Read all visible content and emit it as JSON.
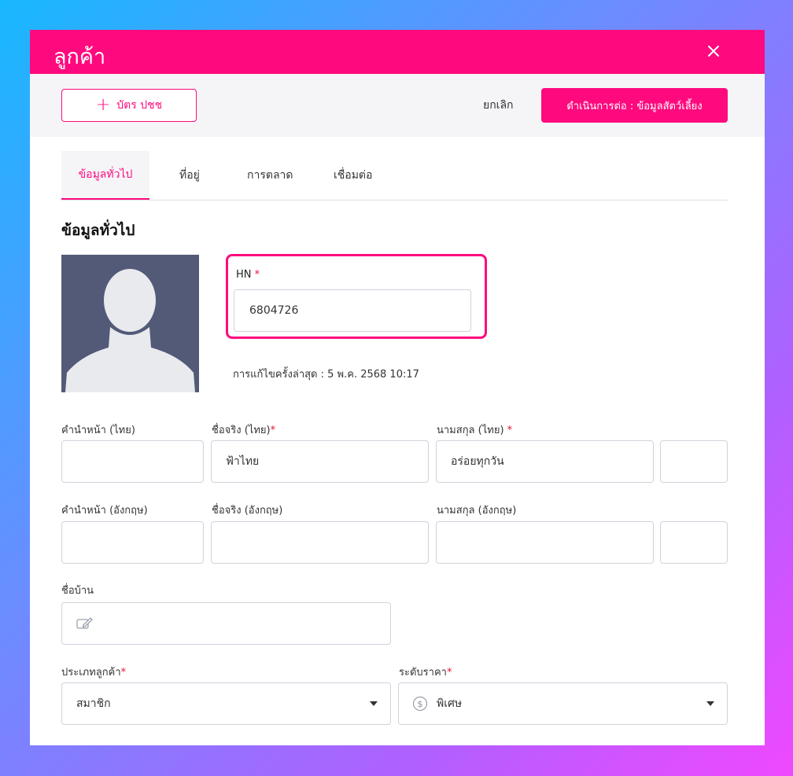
{
  "modal": {
    "title": "ลูกค้า",
    "close_icon": "close-icon"
  },
  "toolbar": {
    "idcard_label": "บัตร ปชช",
    "cancel_label": "ยกเลิก",
    "next_label": "ดำเนินการต่อ : ข้อมูลสัตว์เลี้ยง"
  },
  "tabs": [
    {
      "label": "ข้อมูลทั่วไป",
      "active": true
    },
    {
      "label": "ที่อยู่",
      "active": false
    },
    {
      "label": "การตลาด",
      "active": false
    },
    {
      "label": "เชื่อมต่อ",
      "active": false
    }
  ],
  "section": {
    "title": "ข้อมูลทั่วไป"
  },
  "hn": {
    "label": "HN",
    "required": "*",
    "value": "6804726"
  },
  "last_edit": "การแก้ไขครั้งล่าสุด : 5 พ.ค. 2568 10:17",
  "thai_name": {
    "prefix_label": "คำนำหน้า (ไทย)",
    "first_label": "ชื่อจริง (ไทย)",
    "first_value": "ฟ้าไทย",
    "last_label": "นามสกุล (ไทย)",
    "last_value": "อร่อยทุกวัน"
  },
  "eng_name": {
    "prefix_label": "คำนำหน้า (อังกฤษ)",
    "first_label": "ชื่อจริง (อังกฤษ)",
    "last_label": "นามสกุล (อังกฤษ)"
  },
  "nickname": {
    "label": "ชื่อบ้าน"
  },
  "customer_type": {
    "label": "ประเภทลูกค้า",
    "value": "สมาชิก"
  },
  "price_level": {
    "label": "ระดับราคา",
    "value": "พิเศษ"
  },
  "colors": {
    "brand": "#ff0a7e",
    "required": "#e0153a",
    "avatar_bg": "#535a78"
  }
}
